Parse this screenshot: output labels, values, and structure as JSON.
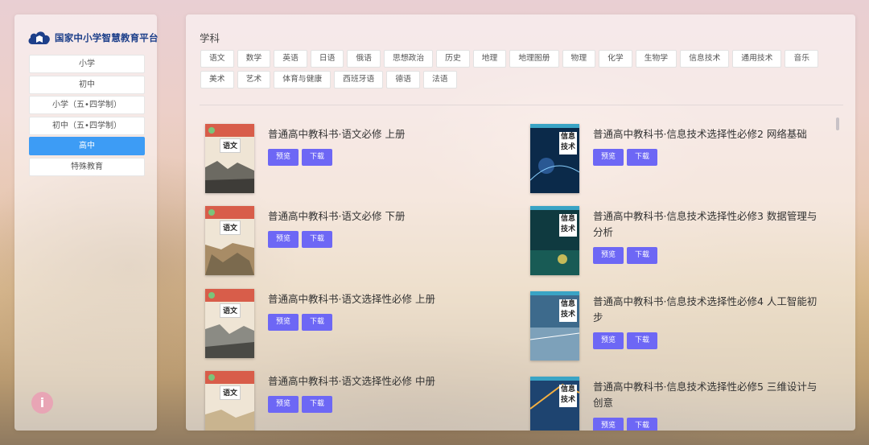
{
  "platform": {
    "name": "国家中小学智慧教育平台"
  },
  "levels": [
    {
      "label": "小学",
      "active": false
    },
    {
      "label": "初中",
      "active": false
    },
    {
      "label": "小学（五•四学制）",
      "active": false
    },
    {
      "label": "初中（五•四学制）",
      "active": false
    },
    {
      "label": "高中",
      "active": true
    },
    {
      "label": "特殊教育",
      "active": false
    }
  ],
  "subjects": {
    "title": "学科",
    "items": [
      "语文",
      "数学",
      "英语",
      "日语",
      "俄语",
      "思想政治",
      "历史",
      "地理",
      "地理图册",
      "物理",
      "化学",
      "生物学",
      "信息技术",
      "通用技术",
      "音乐",
      "美术",
      "艺术",
      "体育与健康",
      "西班牙语",
      "德语",
      "法语"
    ]
  },
  "books": [
    {
      "title": "普通高中教科书·语文必修 上册",
      "cover": "语文",
      "preview": "预览",
      "download": "下载"
    },
    {
      "title": "普通高中教科书·信息技术选择性必修2 网络基础",
      "cover": "信息技术",
      "preview": "预览",
      "download": "下载"
    },
    {
      "title": "普通高中教科书·语文必修 下册",
      "cover": "语文",
      "preview": "预览",
      "download": "下载"
    },
    {
      "title": "普通高中教科书·信息技术选择性必修3 数据管理与分析",
      "cover": "信息技术",
      "preview": "预览",
      "download": "下载"
    },
    {
      "title": "普通高中教科书·语文选择性必修 上册",
      "cover": "语文",
      "preview": "预览",
      "download": "下载"
    },
    {
      "title": "普通高中教科书·信息技术选择性必修4 人工智能初步",
      "cover": "信息技术",
      "preview": "预览",
      "download": "下载"
    },
    {
      "title": "普通高中教科书·语文选择性必修 中册",
      "cover": "语文",
      "preview": "预览",
      "download": "下载"
    },
    {
      "title": "普通高中教科书·信息技术选择性必修5 三维设计与创意",
      "cover": "信息技术",
      "preview": "预览",
      "download": "下载"
    }
  ],
  "colors": {
    "active_level": "#3d9cf5",
    "button": "#6d67f5",
    "logo": "#1d3f8a",
    "info": "#e8a5b5"
  },
  "icons": {
    "logo": "cloud-book-logo-icon",
    "info": "info-icon"
  }
}
